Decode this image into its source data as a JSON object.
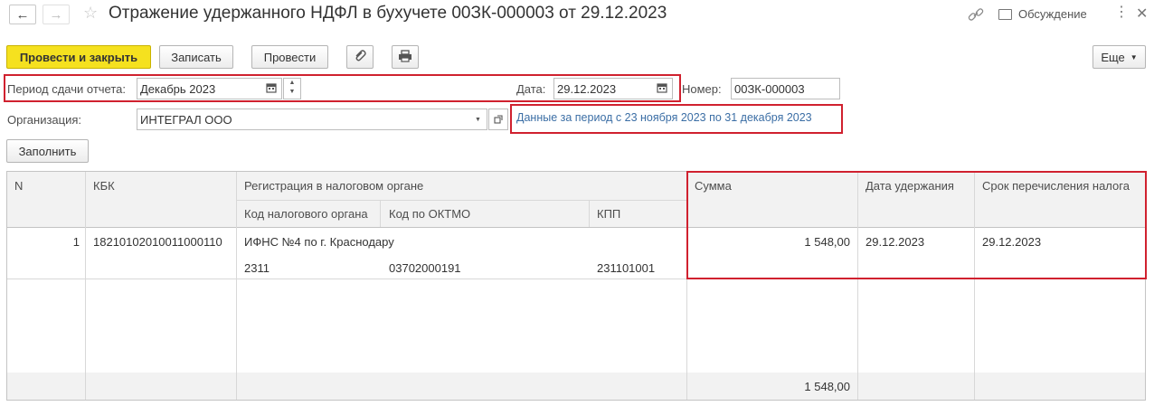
{
  "window": {
    "title": "Отражение удержанного НДФЛ в бухучете 00ЗК-000003 от 29.12.2023",
    "discussion_label": "Обсуждение"
  },
  "toolbar": {
    "post_close_label": "Провести и закрыть",
    "save_label": "Записать",
    "post_label": "Провести",
    "more_label": "Еще"
  },
  "form": {
    "period_label": "Период сдачи отчета:",
    "period_value": "Декабрь 2023",
    "date_label": "Дата:",
    "date_value": "29.12.2023",
    "number_label": "Номер:",
    "number_value": "00ЗК-000003",
    "org_label": "Организация:",
    "org_value": "ИНТЕГРАЛ ООО",
    "period_link": "Данные за период с 23 ноября 2023 по 31 декабря 2023",
    "fill_label": "Заполнить"
  },
  "table": {
    "headers": {
      "n": "N",
      "kbk": "КБК",
      "registration": "Регистрация в налоговом органе",
      "tax_code": "Код налогового органа",
      "oktmo": "Код по ОКТМО",
      "kpp": "КПП",
      "sum": "Сумма",
      "hold_date": "Дата удержания",
      "transfer_term": "Срок перечисления налога"
    },
    "rows": [
      {
        "n": "1",
        "kbk": "18210102010011000110",
        "registration": "ИФНС №4 по г. Краснодару",
        "tax_code": "2311",
        "oktmo": "03702000191",
        "kpp": "231101001",
        "sum": "1 548,00",
        "hold_date": "29.12.2023",
        "transfer_term": "29.12.2023"
      }
    ],
    "total_sum": "1 548,00"
  },
  "colors": {
    "primary_button": "#f5e11f",
    "highlight": "#d0212f",
    "link": "#3b6ea5"
  }
}
